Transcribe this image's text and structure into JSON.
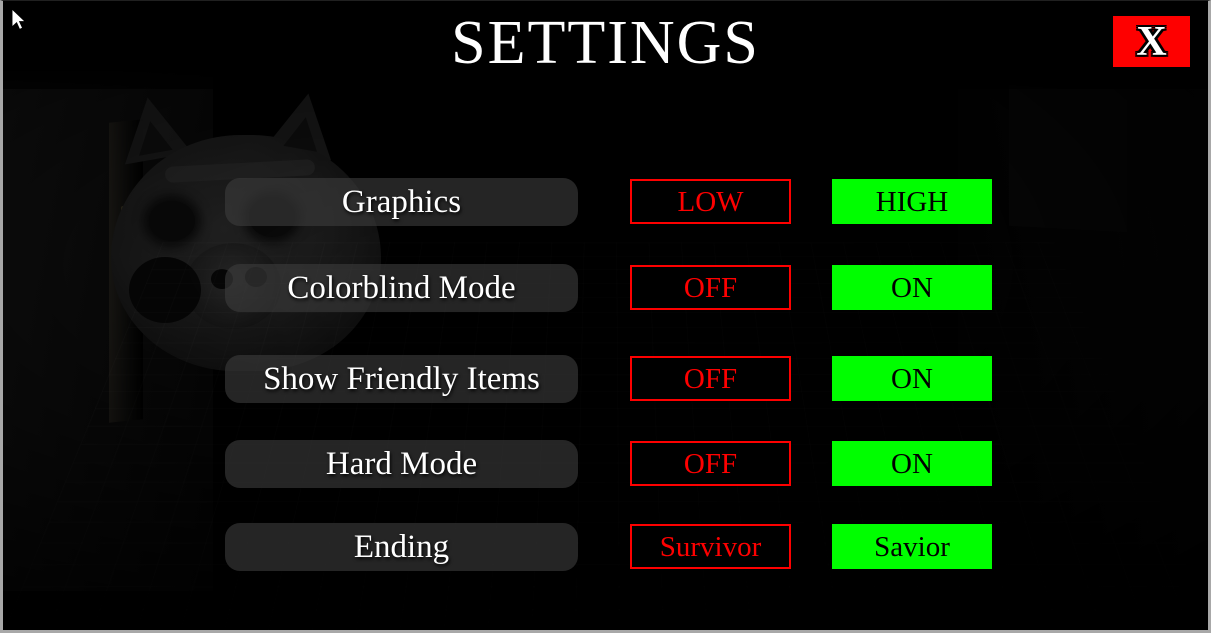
{
  "window": {
    "title": "SETTINGS"
  },
  "header": {
    "title": "SETTINGS",
    "close_label": "X",
    "close_color": "#fe0000"
  },
  "colors": {
    "option_off": "#fe0000",
    "option_on": "#00fe00",
    "label_pill": "rgba(60,60,60,0.62)",
    "text_light": "#ffffff",
    "background": "#000000"
  },
  "settings": {
    "rows": [
      {
        "label": "Graphics",
        "off_label": "LOW",
        "on_label": "HIGH"
      },
      {
        "label": "Colorblind Mode",
        "off_label": "OFF",
        "on_label": "ON"
      },
      {
        "label": "Show Friendly Items",
        "off_label": "OFF",
        "on_label": "ON"
      },
      {
        "label": "Hard Mode",
        "off_label": "OFF",
        "on_label": "ON"
      },
      {
        "label": "Ending",
        "off_label": "Survivor",
        "on_label": "Savior"
      }
    ]
  },
  "cursor": {
    "icon": "arrow-pointer-icon"
  }
}
